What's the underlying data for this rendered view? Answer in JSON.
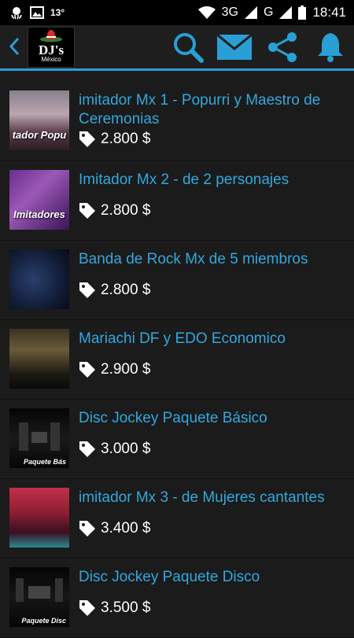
{
  "status_bar": {
    "temperature": "13°",
    "network": "3G",
    "carrier_signal": "G",
    "time": "18:41"
  },
  "app_bar": {
    "logo_text": "DJ's",
    "logo_subtext": "México",
    "back_icon": "chevron-left-icon",
    "actions": [
      "search-icon",
      "mail-icon",
      "share-icon",
      "bell-icon"
    ],
    "accent_color": "#2a9fd6"
  },
  "items": [
    {
      "title": "imitador Mx 1 - Popurri y Maestro de Ceremonias",
      "price": "2.800 $",
      "thumb_label": "tador Popu"
    },
    {
      "title": "Imitador Mx 2 - de 2 personajes",
      "price": "2.800 $",
      "thumb_label": "Imitadores"
    },
    {
      "title": "Banda de Rock Mx  de 5 miembros",
      "price": "2.800 $",
      "thumb_label": ""
    },
    {
      "title": "Mariachi DF y EDO Economico",
      "price": "2.900 $",
      "thumb_label": ""
    },
    {
      "title": "Disc Jockey  Paquete Básico",
      "price": "3.000 $",
      "thumb_label": "Paquete Bás"
    },
    {
      "title": "imitador Mx 3 - de Mujeres cantantes",
      "price": "3.400 $",
      "thumb_label": ""
    },
    {
      "title": "Disc Jockey  Paquete Disco",
      "price": "3.500 $",
      "thumb_label": "Paquete Disc"
    }
  ]
}
